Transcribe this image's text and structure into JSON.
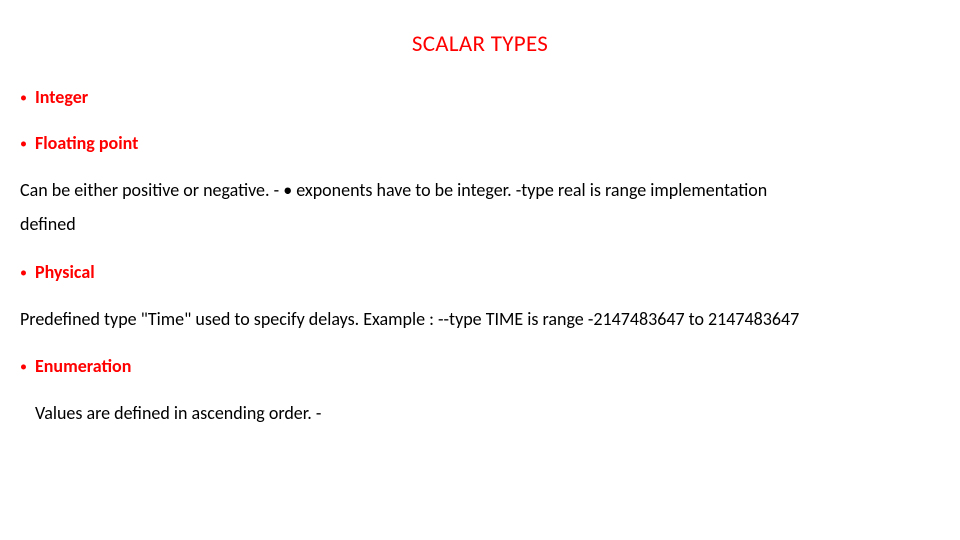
{
  "title": "SCALAR TYPES",
  "items": [
    {
      "bullet": "•",
      "label": "Integer"
    },
    {
      "bullet": "•",
      "label": "Floating point"
    }
  ],
  "floating_desc_1": " Can be either positive or negative. -   • exponents have to be integer. -type real is range implementation",
  "floating_desc_2": "defined",
  "physical": {
    "bullet": "•",
    "label": "Physical"
  },
  "physical_desc": "Predefined type \"Time\" used to specify delays.    Example :    --type TIME is range -2147483647 to 2147483647",
  "enum": {
    "bullet": "•",
    "label": " Enumeration"
  },
  "enum_desc": "Values are defined in ascending order. -"
}
